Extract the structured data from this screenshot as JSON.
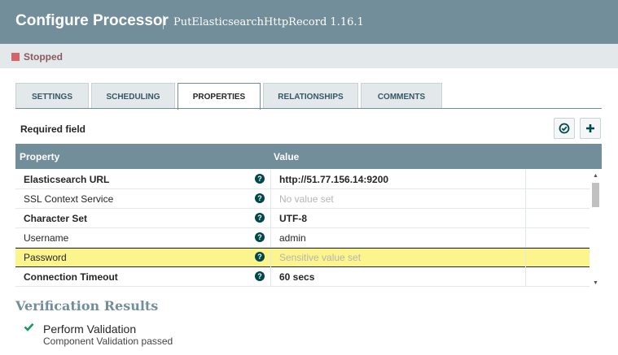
{
  "dialog": {
    "title": "Configure Processor",
    "subtitle": "PutElasticsearchHttpRecord 1.16.1"
  },
  "status": {
    "label": "Stopped",
    "color": "#d4646c"
  },
  "tabs": [
    {
      "label": "SETTINGS",
      "active": false
    },
    {
      "label": "SCHEDULING",
      "active": false
    },
    {
      "label": "PROPERTIES",
      "active": true
    },
    {
      "label": "RELATIONSHIPS",
      "active": false
    },
    {
      "label": "COMMENTS",
      "active": false
    }
  ],
  "required_label": "Required field",
  "buttons": {
    "verify_icon": "check-circle-icon",
    "add_icon": "plus-icon"
  },
  "table": {
    "headers": {
      "property": "Property",
      "value": "Value"
    },
    "rows": [
      {
        "name": "Elasticsearch URL",
        "value": "http://51.77.156.14:9200",
        "required": true
      },
      {
        "name": "SSL Context Service",
        "value": "No value set",
        "required": false,
        "empty": true
      },
      {
        "name": "Character Set",
        "value": "UTF-8",
        "required": true
      },
      {
        "name": "Username",
        "value": "admin",
        "required": false
      },
      {
        "name": "Password",
        "value": "Sensitive value set",
        "required": false,
        "empty": true,
        "selected": true
      },
      {
        "name": "Connection Timeout",
        "value": "60 secs",
        "required": true
      }
    ],
    "help_glyph": "?"
  },
  "verification": {
    "title": "Verification Results",
    "items": [
      {
        "title": "Perform Validation",
        "detail": "Component Validation passed",
        "icon": "check-icon"
      }
    ]
  },
  "colors": {
    "header": "#728e9b",
    "selected_row": "#fcf48d",
    "success": "#1a9964"
  }
}
